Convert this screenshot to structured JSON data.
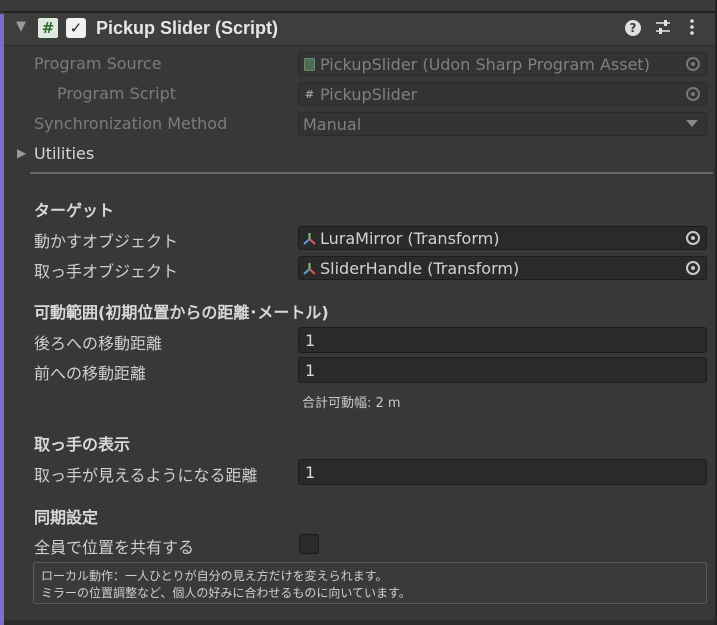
{
  "component": {
    "title": "Pickup Slider (Script)",
    "enabled_check": "✓",
    "script_icon": "#"
  },
  "icons": {
    "foldout": "foldout-arrow-icon",
    "script": "csharp-script-icon",
    "help": "help-icon",
    "presets": "presets-sliders-icon",
    "menu": "kebab-menu-icon"
  },
  "udon": {
    "program_source_label": "Program Source",
    "program_source_value": "PickupSlider (Udon Sharp Program Asset)",
    "program_script_label": "Program Script",
    "program_script_value": "PickupSlider",
    "sync_method_label": "Synchronization Method",
    "sync_method_value": "Manual",
    "utilities_label": "Utilities"
  },
  "target": {
    "header": "ターゲット",
    "move_object_label": "動かすオブジェクト",
    "move_object_value": "LuraMirror (Transform)",
    "handle_object_label": "取っ手オブジェクト",
    "handle_object_value": "SliderHandle (Transform)"
  },
  "range": {
    "header": "可動範囲(初期位置からの距離･メートル)",
    "back_label": "後ろへの移動距離",
    "back_value": "1",
    "forward_label": "前への移動距離",
    "forward_value": "1",
    "total_note": "合計可動幅: 2 m"
  },
  "handle_display": {
    "header": "取っ手の表示",
    "visible_distance_label": "取っ手が見えるようになる距離",
    "visible_distance_value": "1"
  },
  "sync": {
    "header": "同期設定",
    "share_label": "全員で位置を共有する",
    "share_checked": false,
    "help_line1": "ローカル動作：一人ひとりが自分の見え方だけを変えられます。",
    "help_line2": "ミラーの位置調整など、個人の好みに合わせるものに向いています。"
  },
  "colors": {
    "accent": "#7a6fd0",
    "background": "#383838",
    "field": "#2a2a2a"
  }
}
